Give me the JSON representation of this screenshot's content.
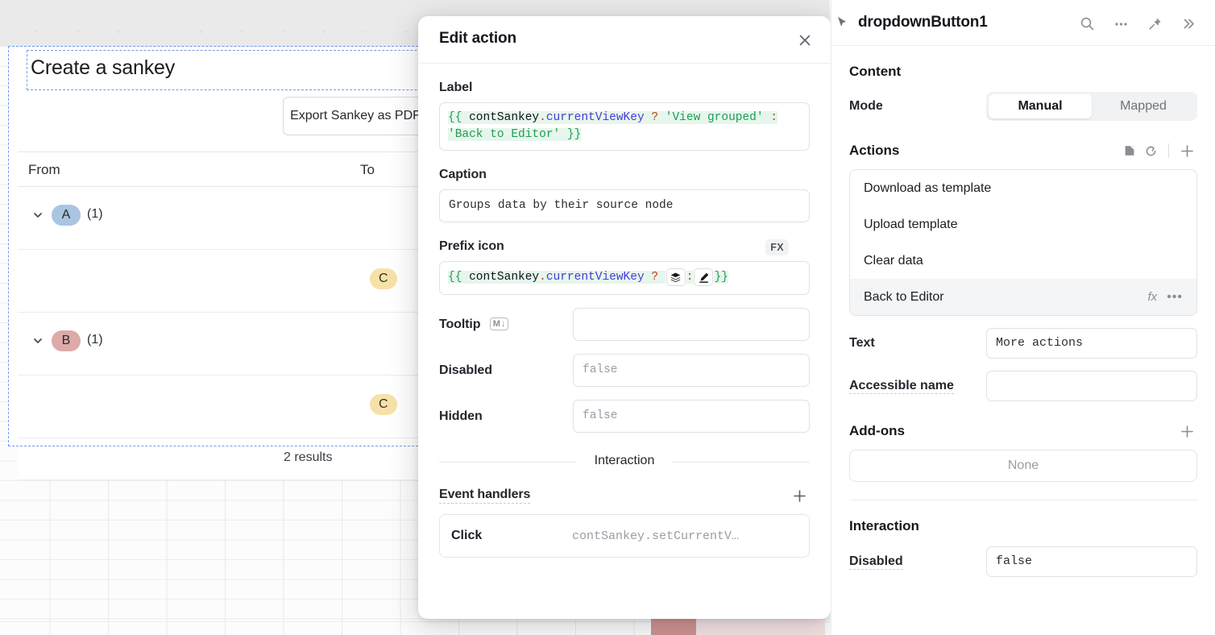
{
  "canvas": {
    "app_title": "Create a sankey",
    "export_button": "Export Sankey as PDF",
    "table": {
      "columns": [
        "From",
        "To"
      ],
      "groups": [
        {
          "key": "A",
          "count": "(1)",
          "color": "#aac5e2",
          "to": "C"
        },
        {
          "key": "B",
          "count": "(1)",
          "color": "#dda9a9",
          "to": "C"
        }
      ],
      "to_pill_color": "#f6e2a8",
      "results": "2 results"
    }
  },
  "modal": {
    "title": "Edit action",
    "close_icon": "close-icon",
    "label": {
      "title": "Label",
      "expr_tokens": [
        {
          "t": "{{ ",
          "k": "brace"
        },
        {
          "t": "contSankey",
          "k": "obj"
        },
        {
          "t": ".",
          "k": "op"
        },
        {
          "t": "currentViewKey",
          "k": "prop"
        },
        {
          "t": " ",
          "k": "plain"
        },
        {
          "t": "?",
          "k": "op"
        },
        {
          "t": " 'View grouped'",
          "k": "str"
        },
        {
          "t": " ",
          "k": "plain"
        },
        {
          "t": ":",
          "k": "op"
        },
        {
          "t": " 'Back to Editor'",
          "k": "str"
        },
        {
          "t": " }}",
          "k": "brace"
        }
      ]
    },
    "caption": {
      "title": "Caption",
      "value": "Groups data by their source node"
    },
    "prefix_icon": {
      "title": "Prefix icon",
      "fx_badge": "FX",
      "expr_prefix_tokens": [
        {
          "t": "{{ ",
          "k": "brace"
        },
        {
          "t": "contSankey",
          "k": "obj"
        },
        {
          "t": ".",
          "k": "op"
        },
        {
          "t": "currentViewKey",
          "k": "prop"
        },
        {
          "t": " ",
          "k": "plain"
        },
        {
          "t": "?",
          "k": "op"
        },
        {
          "t": "  ",
          "k": "plain"
        }
      ],
      "chip_1_icon": "layers-icon",
      "chip_separator": ":",
      "chip_2_icon": "pen-icon",
      "expr_suffix_tokens": [
        {
          "t": "}}",
          "k": "brace"
        }
      ]
    },
    "tooltip": {
      "title": "Tooltip",
      "badge": "M",
      "badge_arrow": "↓",
      "value": ""
    },
    "disabled": {
      "title": "Disabled",
      "placeholder": "false"
    },
    "hidden": {
      "title": "Hidden",
      "placeholder": "false"
    },
    "interaction_divider": "Interaction",
    "event_handlers": {
      "title": "Event handlers",
      "add_icon": "plus-icon",
      "rows": [
        {
          "name": "Click",
          "value": "contSankey.setCurrentV…"
        }
      ]
    }
  },
  "inspector": {
    "component_name": "dropdownButton1",
    "header_icons": [
      "cursor-icon",
      "search-icon",
      "more-icon",
      "pin-icon",
      "expand-icon"
    ],
    "content_section": "Content",
    "mode": {
      "label": "Mode",
      "options": [
        "Manual",
        "Mapped"
      ],
      "selected": "Manual"
    },
    "actions": {
      "title": "Actions",
      "icons": [
        "book-icon",
        "refresh-icon",
        "plus-icon"
      ],
      "items": [
        {
          "label": "Download as template",
          "selected": false
        },
        {
          "label": "Upload template",
          "selected": false
        },
        {
          "label": "Clear data",
          "selected": false
        },
        {
          "label": "Back to Editor",
          "selected": true,
          "fx": "fx",
          "more": "•••"
        }
      ]
    },
    "text_field": {
      "label": "Text",
      "value": "More actions"
    },
    "accessible_name": {
      "label": "Accessible name",
      "value": ""
    },
    "addons": {
      "label": "Add-ons",
      "empty": "None",
      "add_icon": "plus-icon"
    },
    "interaction_section": "Interaction",
    "disabled": {
      "label": "Disabled",
      "placeholder": "false"
    }
  }
}
